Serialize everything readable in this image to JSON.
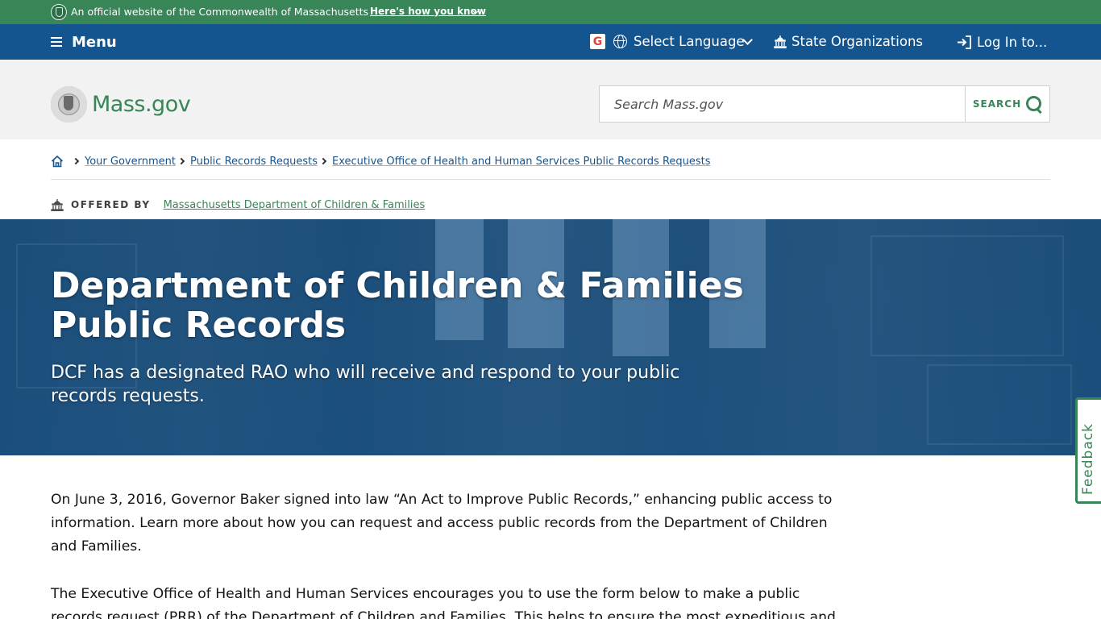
{
  "official_banner": {
    "text": "An official website of the Commonwealth of Massachusetts",
    "link": "Here's how you know"
  },
  "utility_nav": {
    "menu": "Menu",
    "language": "Select Language",
    "organizations": "State Organizations",
    "login": "Log In to..."
  },
  "header": {
    "logo_text": "Mass.gov",
    "search_placeholder": "Search Mass.gov",
    "search_button": "SEARCH"
  },
  "breadcrumb": {
    "items": [
      "Your Government",
      "Public Records Requests",
      "Executive Office of Health and Human Services Public Records Requests"
    ]
  },
  "offered_by": {
    "label": "OFFERED BY",
    "organization": "Massachusetts Department of Children & Families"
  },
  "hero": {
    "title": "Department of Children & Families Public Records",
    "subtitle": "DCF has a designated RAO who will receive and respond to your public records requests."
  },
  "feedback": "Feedback",
  "content": {
    "paragraphs": [
      "On June 3, 2016, Governor Baker signed into law “An Act to Improve Public Records,” enhancing public access to information. Learn more about how you can request and access public records from the Department of Children and Families.",
      "The Executive Office of Health and Human Services encourages you to use the form below to make a public records request (PRR) of the Department of Children and Families. This helps to ensure the most expeditious and"
    ]
  },
  "colors": {
    "banner_green": "#388557",
    "nav_blue": "#14558f",
    "header_gray": "#f2f2f2"
  }
}
